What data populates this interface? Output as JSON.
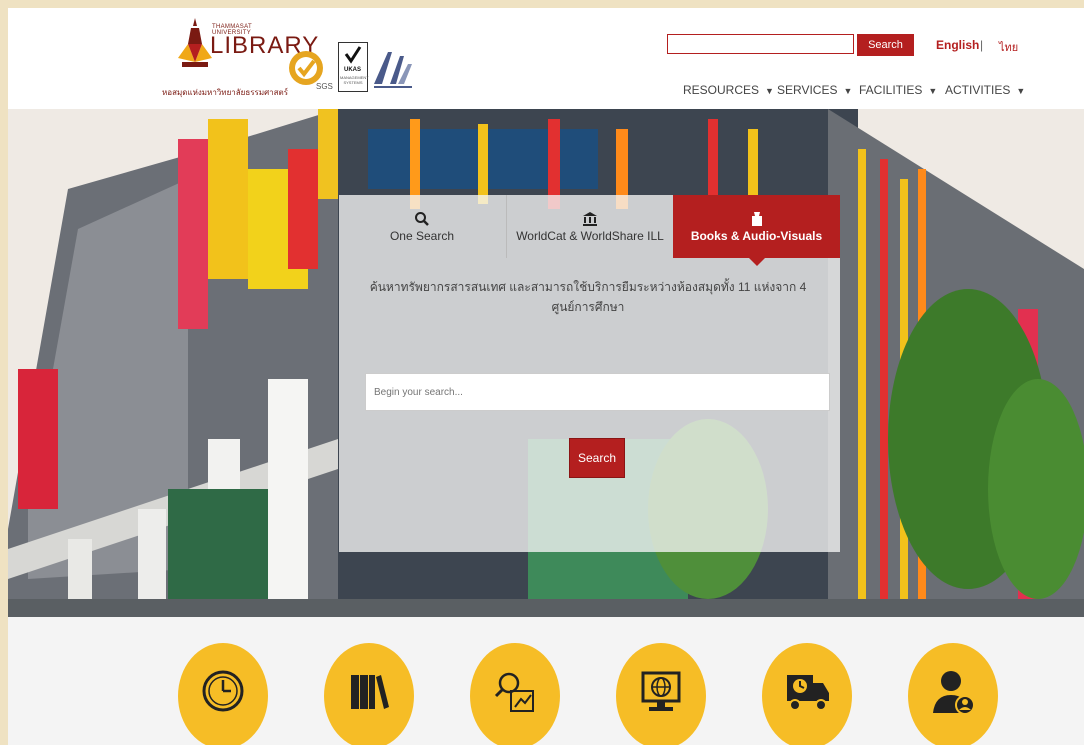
{
  "header": {
    "logo_small": "THAMMASAT UNIVERSITY",
    "logo_big": "LIBRARY",
    "logo_thai": "หอสมุดแห่งมหาวิทยาลัยธรรมศาสตร์",
    "badges": {
      "sgs": "SGS",
      "ukas_line1": "UKAS",
      "ukas_line2": "MANAGEMENT SYSTEMS"
    },
    "search_placeholder": "",
    "search_button": "Search",
    "lang_en": "English",
    "lang_sep": "|",
    "lang_th": "ไทย",
    "nav": [
      {
        "label": "RESOURCES"
      },
      {
        "label": "SERVICES"
      },
      {
        "label": "FACILITIES"
      },
      {
        "label": "ACTIVITIES"
      }
    ],
    "caret": "▼"
  },
  "panel": {
    "tabs": [
      {
        "label": "One Search",
        "icon": "search-icon"
      },
      {
        "label": "WorldCat & WorldShare ILL",
        "icon": "institution-icon"
      },
      {
        "label": "Books & Audio-Visuals",
        "icon": "book-icon",
        "active": true
      }
    ],
    "description": "ค้นหาทรัพยากรสารสนเทศ และสามารถใช้บริการยืมระหว่างห้องสมุดทั้ง 11 แห่งจาก 4 ศูนย์การศึกษา",
    "input_placeholder": "Begin your search...",
    "search_button": "Search"
  },
  "quick_links": [
    {
      "icon": "clock-icon"
    },
    {
      "icon": "books-icon"
    },
    {
      "icon": "research-icon"
    },
    {
      "icon": "e-resources-icon"
    },
    {
      "icon": "delivery-icon"
    },
    {
      "icon": "user-account-icon"
    }
  ],
  "colors": {
    "brand_red": "#b41f1f",
    "circle_yellow": "#f6bd26",
    "logo_maroon": "#7a1a12"
  }
}
